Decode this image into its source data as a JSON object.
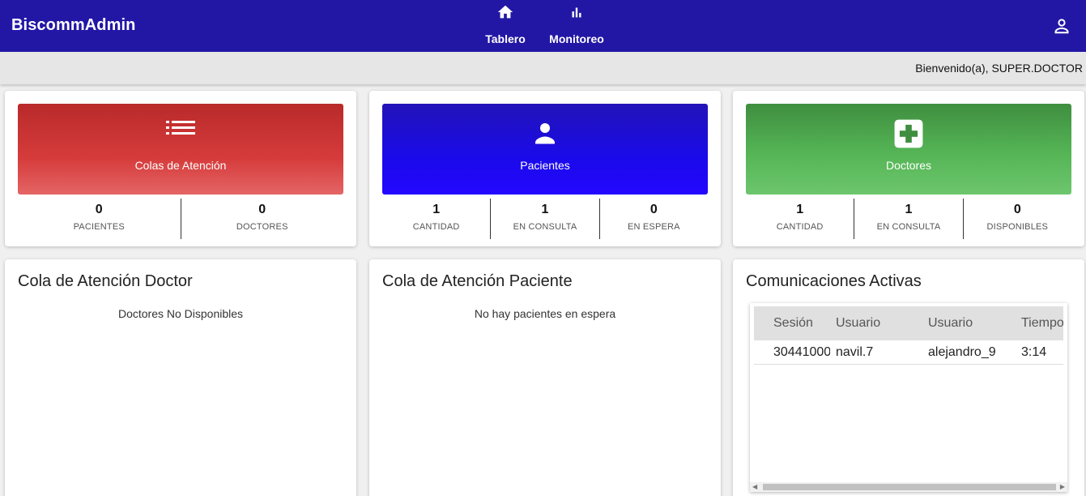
{
  "app": {
    "title": "BiscommAdmin"
  },
  "nav": {
    "items": [
      {
        "label": "Tablero",
        "icon": "home-icon"
      },
      {
        "label": "Monitoreo",
        "icon": "bar-chart-icon"
      }
    ],
    "user_icon": "account-icon"
  },
  "welcome": {
    "text": "Bienvenido(a), SUPER.DOCTOR"
  },
  "stats": [
    {
      "title": "Colas de Atención",
      "icon": "list-icon",
      "color": "#d63b3b",
      "metrics": [
        {
          "value": "0",
          "label": "PACIENTES"
        },
        {
          "value": "0",
          "label": "DOCTORES"
        }
      ]
    },
    {
      "title": "Pacientes",
      "icon": "person-icon",
      "color": "#1a0aea",
      "metrics": [
        {
          "value": "1",
          "label": "CANTIDAD"
        },
        {
          "value": "1",
          "label": "EN CONSULTA"
        },
        {
          "value": "0",
          "label": "EN ESPERA"
        }
      ]
    },
    {
      "title": "Doctores",
      "icon": "medical-plus-icon",
      "color": "#55b555",
      "metrics": [
        {
          "value": "1",
          "label": "CANTIDAD"
        },
        {
          "value": "1",
          "label": "EN CONSULTA"
        },
        {
          "value": "0",
          "label": "DISPONIBLES"
        }
      ]
    }
  ],
  "doctor_queue": {
    "title": "Cola de Atención Doctor",
    "empty_text": "Doctores No Disponibles"
  },
  "patient_queue": {
    "title": "Cola de Atención Paciente",
    "empty_text": "No hay pacientes en espera"
  },
  "active_comms": {
    "title": "Comunicaciones Activas",
    "columns": [
      "Sesión",
      "Usuario",
      "Usuario",
      "Tiempo"
    ],
    "rows": [
      [
        "30441000",
        "navil.7",
        "alejandro_9",
        "3:14"
      ]
    ]
  },
  "colors": {
    "topbar": "#2217a5",
    "accent": "#2217a5"
  }
}
